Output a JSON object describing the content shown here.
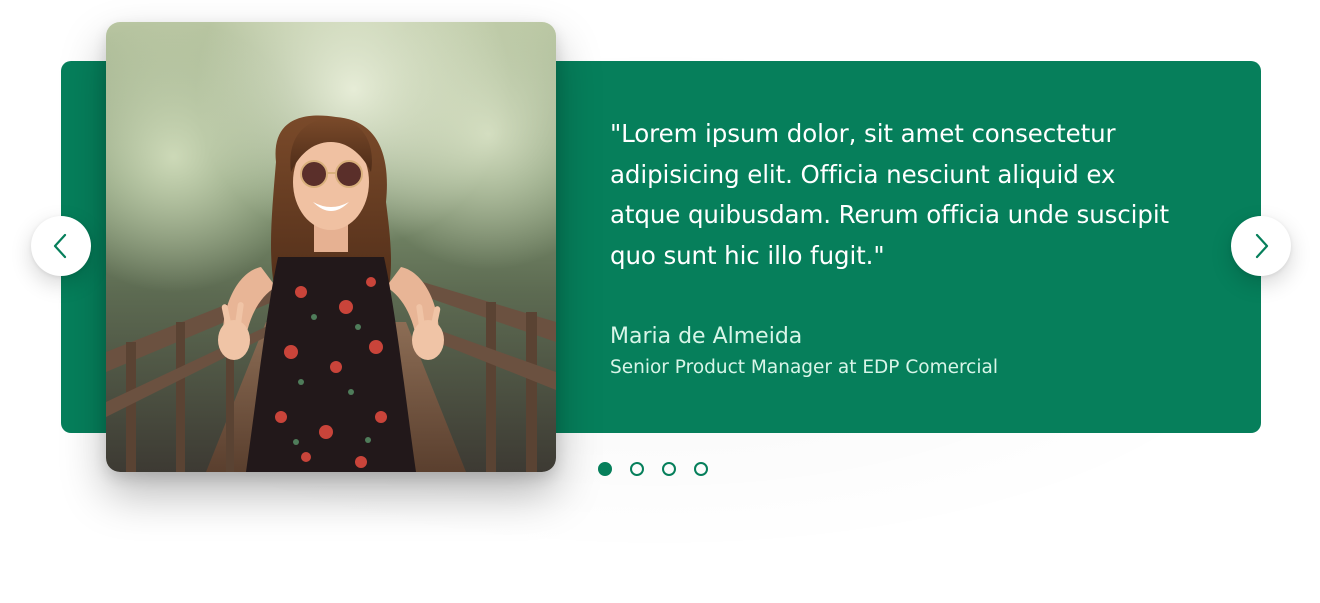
{
  "colors": {
    "brand_green": "#067f5b",
    "text_on_green": "#ffffff",
    "author_text": "#d8f5e8",
    "nav_icon": "#067f5b"
  },
  "testimonial": {
    "quote": "\"Lorem ipsum dolor, sit amet consectetur adipisicing elit. Officia nesciunt aliquid ex atque quibusdam. Rerum officia unde suscipit quo sunt hic illo fugit.\"",
    "author_name": "Maria de Almeida",
    "author_role": "Senior Product Manager at EDP Comercial",
    "photo_icon": "portrait-photo"
  },
  "navigation": {
    "prev_icon": "chevron-left-icon",
    "next_icon": "chevron-right-icon"
  },
  "pagination": {
    "total": 4,
    "active_index": 0
  }
}
